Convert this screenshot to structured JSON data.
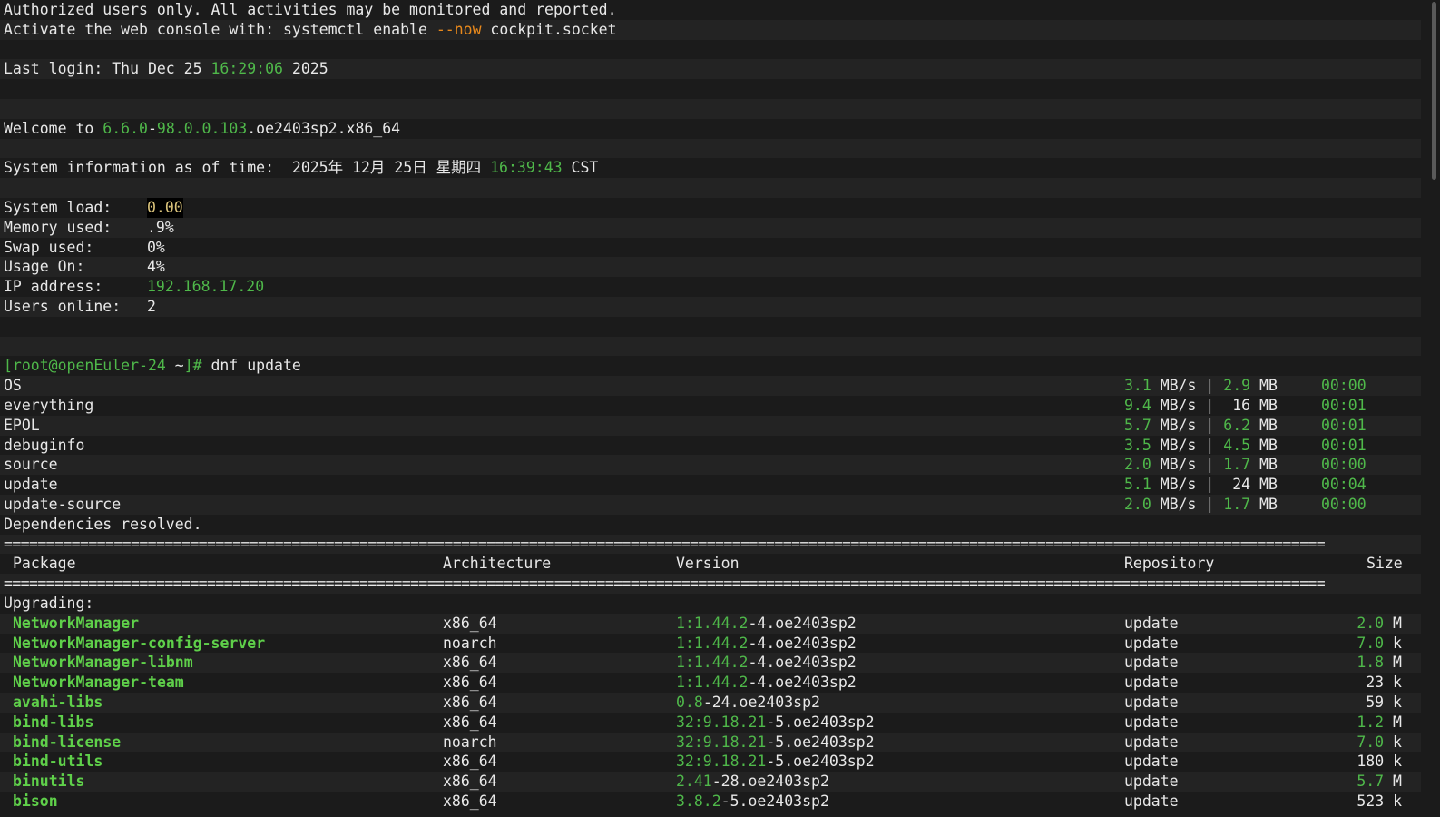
{
  "banner": {
    "line1": "Authorized users only. All activities may be monitored and reported.",
    "line2_pre": "Activate the web console with: systemctl enable ",
    "line2_flag": "--now",
    "line2_post": " cockpit.socket"
  },
  "last_login": {
    "pre": "Last login: Thu Dec 25 ",
    "time": "16:29:06",
    "post": " 2025"
  },
  "welcome": {
    "pre": "Welcome to ",
    "v1": "6.6.0",
    "sep": "-",
    "v2": "98.0.0.103",
    "post": ".oe2403sp2.x86_64"
  },
  "sysinfo": {
    "pre": "System information as of time:  2025年 12月 25日 星期四 ",
    "time": "16:39:43",
    "post": " CST",
    "rows": [
      {
        "label": "System load:",
        "value": "0.00"
      },
      {
        "label": "Memory used:",
        "value": ".9%"
      },
      {
        "label": "Swap used:",
        "value": "0%"
      },
      {
        "label": "Usage On:",
        "value": "4%"
      },
      {
        "label": "IP address:",
        "value": "192.168.17.20"
      },
      {
        "label": "Users online:",
        "value": "2"
      }
    ]
  },
  "prompt": {
    "user_host": "[root@openEuler-24",
    "path": " ~",
    "end": "]#",
    "command": " dnf update"
  },
  "repos": [
    {
      "name": "OS",
      "speed": "3.1",
      "speed_unit": " MB/s |",
      "size": "2.9",
      "size_unit": " MB",
      "time": "00:00"
    },
    {
      "name": "everything",
      "speed": "9.4",
      "speed_unit": " MB/s |",
      "size": " 16",
      "size_unit": " MB",
      "time": "00:01"
    },
    {
      "name": "EPOL",
      "speed": "5.7",
      "speed_unit": " MB/s |",
      "size": "6.2",
      "size_unit": " MB",
      "time": "00:01"
    },
    {
      "name": "debuginfo",
      "speed": "3.5",
      "speed_unit": " MB/s |",
      "size": "4.5",
      "size_unit": " MB",
      "time": "00:01"
    },
    {
      "name": "source",
      "speed": "2.0",
      "speed_unit": " MB/s |",
      "size": "1.7",
      "size_unit": " MB",
      "time": "00:00"
    },
    {
      "name": "update",
      "speed": "5.1",
      "speed_unit": " MB/s |",
      "size": " 24",
      "size_unit": " MB",
      "time": "00:04"
    },
    {
      "name": "update-source",
      "speed": "2.0",
      "speed_unit": " MB/s |",
      "size": "1.7",
      "size_unit": " MB",
      "time": "00:00"
    }
  ],
  "deps_resolved": "Dependencies resolved.",
  "table": {
    "separator": "============================================================================================================================================================",
    "headers": {
      "package": "Package",
      "arch": "Architecture",
      "version": "Version",
      "repo": "Repository",
      "size": "Size"
    },
    "section": "Upgrading:",
    "rows": [
      {
        "name": "NetworkManager",
        "arch": "x86_64",
        "ver_g": "1:1.44.2",
        "ver_w": "-4.oe2403sp2",
        "repo": "update",
        "size_g": "2.0",
        "size_u": " M"
      },
      {
        "name": "NetworkManager-config-server",
        "arch": "noarch",
        "ver_g": "1:1.44.2",
        "ver_w": "-4.oe2403sp2",
        "repo": "update",
        "size_g": "7.0",
        "size_u": " k"
      },
      {
        "name": "NetworkManager-libnm",
        "arch": "x86_64",
        "ver_g": "1:1.44.2",
        "ver_w": "-4.oe2403sp2",
        "repo": "update",
        "size_g": "1.8",
        "size_u": " M"
      },
      {
        "name": "NetworkManager-team",
        "arch": "x86_64",
        "ver_g": "1:1.44.2",
        "ver_w": "-4.oe2403sp2",
        "repo": "update",
        "size_g": "",
        "size_u": "23 k"
      },
      {
        "name": "avahi-libs",
        "arch": "x86_64",
        "ver_g": "0.8",
        "ver_w": "-24.oe2403sp2",
        "repo": "update",
        "size_g": "",
        "size_u": "59 k"
      },
      {
        "name": "bind-libs",
        "arch": "x86_64",
        "ver_g": "32:9.18.21",
        "ver_w": "-5.oe2403sp2",
        "repo": "update",
        "size_g": "1.2",
        "size_u": " M"
      },
      {
        "name": "bind-license",
        "arch": "noarch",
        "ver_g": "32:9.18.21",
        "ver_w": "-5.oe2403sp2",
        "repo": "update",
        "size_g": "7.0",
        "size_u": " k"
      },
      {
        "name": "bind-utils",
        "arch": "x86_64",
        "ver_g": "32:9.18.21",
        "ver_w": "-5.oe2403sp2",
        "repo": "update",
        "size_g": "",
        "size_u": "180 k"
      },
      {
        "name": "binutils",
        "arch": "x86_64",
        "ver_g": "2.41",
        "ver_w": "-28.oe2403sp2",
        "repo": "update",
        "size_g": "5.7",
        "size_u": " M"
      },
      {
        "name": "bison",
        "arch": "x86_64",
        "ver_g": "3.8.2",
        "ver_w": "-5.oe2403sp2",
        "repo": "update",
        "size_g": "",
        "size_u": "523 k"
      }
    ]
  }
}
